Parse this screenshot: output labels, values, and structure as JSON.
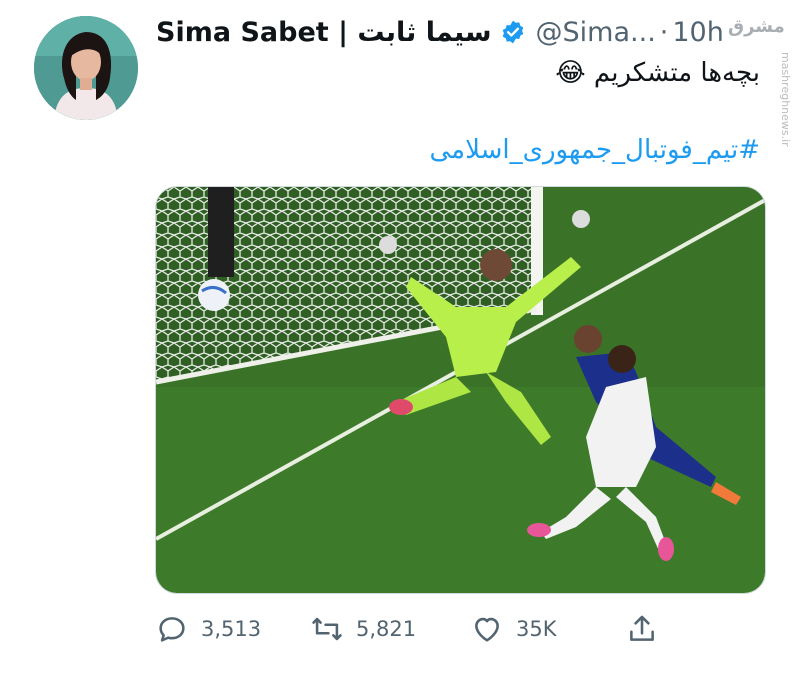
{
  "tweet": {
    "author_name": "Sima Sabet | سیما ثابت",
    "handle": "@Sima...",
    "separator": "·",
    "time": "10h",
    "text": "بچه‌ها متشکریم 😂",
    "hashtag": "#تیم_فوتبال_جمهوری_اسلامی"
  },
  "actions": {
    "replies": "3,513",
    "retweets": "5,821",
    "likes": "35K"
  },
  "watermark": {
    "site": "mashreghnews.ir",
    "logo": "مشرق"
  },
  "icons": {
    "verified": "verified-badge-icon",
    "reply": "reply-icon",
    "retweet": "retweet-icon",
    "like": "heart-icon",
    "share": "share-icon"
  },
  "colors": {
    "link": "#1d9bf0",
    "secondary_text": "#536471",
    "pitch": "#3f7d2c",
    "keeper_kit": "#b8ef4a"
  }
}
